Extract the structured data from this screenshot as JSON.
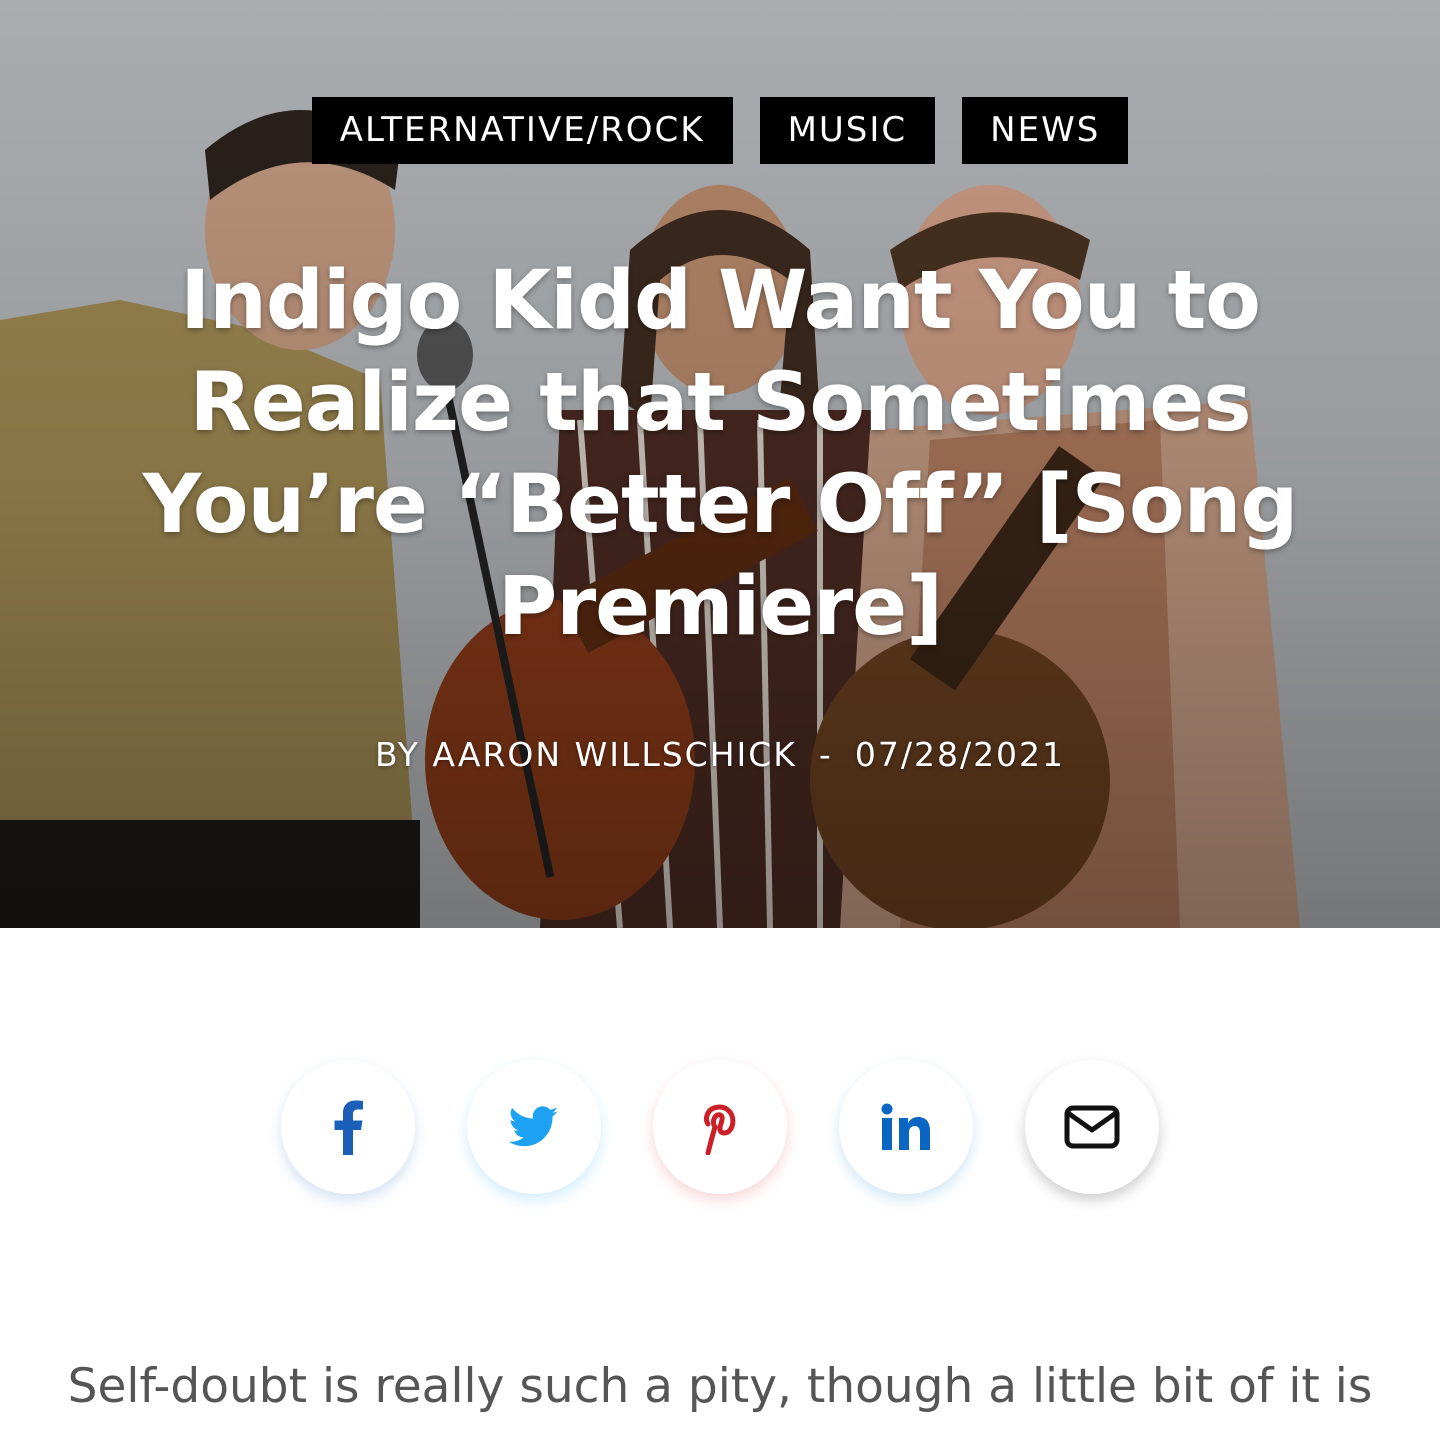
{
  "tags": [
    "ALTERNATIVE/ROCK",
    "MUSIC",
    "NEWS"
  ],
  "article": {
    "title_lines": [
      "Indigo Kidd Want You to",
      "Realize that Sometimes",
      "You’re “Better Off” [Song",
      "Premiere]"
    ],
    "byline": "BY AARON WILLSCHICK",
    "separator": "-",
    "date": "07/28/2021",
    "body_first_line": "Self-doubt is really such a pity, though a little bit of it is"
  },
  "share": [
    {
      "name": "facebook",
      "icon": "facebook-icon",
      "color": "#1b5fb8"
    },
    {
      "name": "twitter",
      "icon": "twitter-icon",
      "color": "#1da1f2"
    },
    {
      "name": "pinterest",
      "icon": "pinterest-icon",
      "color": "#cb2027"
    },
    {
      "name": "linkedin",
      "icon": "linkedin-icon",
      "color": "#0a66c2"
    },
    {
      "name": "email",
      "icon": "envelope-icon",
      "color": "#111111"
    }
  ],
  "colors": {
    "tag_background": "#000000",
    "title_text": "#ffffff",
    "body_text": "#555555"
  }
}
